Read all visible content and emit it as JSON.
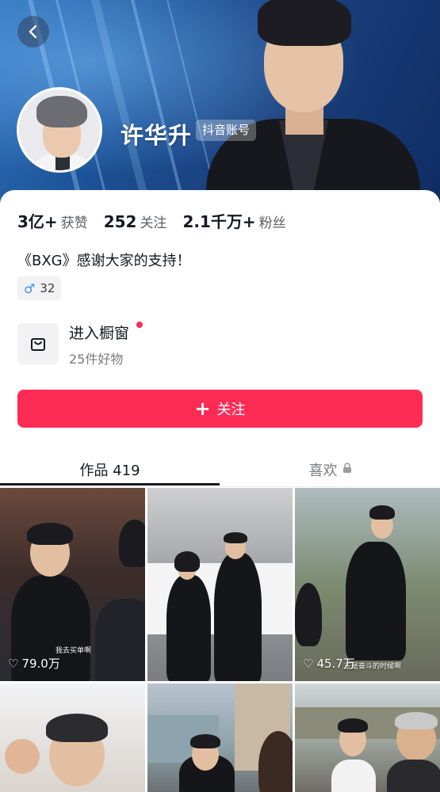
{
  "profile": {
    "name": "许华升",
    "account_tag": "抖音账号",
    "bio": "《BXG》感谢大家的支持！",
    "gender_age": "32"
  },
  "stats": [
    {
      "value": "3亿+",
      "label": "获赞"
    },
    {
      "value": "252",
      "label": "关注"
    },
    {
      "value": "2.1千万+",
      "label": "粉丝"
    }
  ],
  "shop": {
    "title": "进入橱窗",
    "subtitle": "25件好物"
  },
  "follow_button": {
    "label": "关注"
  },
  "tabs": {
    "works": "作品 419",
    "likes": "喜欢"
  },
  "videos": [
    {
      "likes": "79.0万",
      "caption": "我去买单啊"
    },
    {
      "likes": "",
      "caption": ""
    },
    {
      "likes": "45.7万",
      "caption": "正是奋斗的时候啊"
    },
    {
      "likes": "",
      "caption": ""
    },
    {
      "likes": "",
      "caption": ""
    },
    {
      "likes": "",
      "caption": ""
    }
  ],
  "colors": {
    "accent": "#fe2c55",
    "male_icon": "#3d8ef0",
    "banner": "#1b4f93"
  },
  "icons": {
    "back": "chevron-left-icon",
    "shop": "shopping-bag-icon",
    "gender": "male-icon",
    "lock": "lock-icon",
    "heart": "heart-icon",
    "plus": "plus-icon"
  }
}
